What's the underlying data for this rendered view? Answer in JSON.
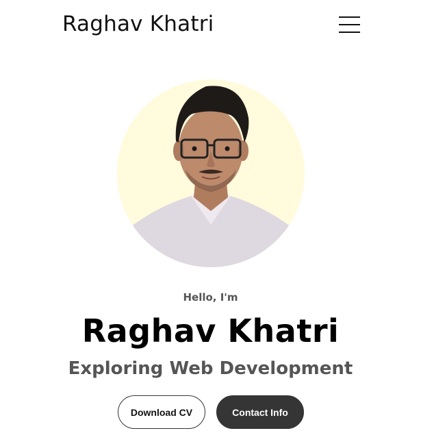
{
  "header": {
    "logo_text": "Raghav Khatri",
    "menu_icon": "hamburger-menu-icon"
  },
  "hero": {
    "profile_image_alt": "Profile photo of Raghav Khatri",
    "greeting": "Hello, I'm",
    "name": "Raghav Khatri",
    "tagline": "Exploring Web Development",
    "buttons": {
      "download_cv": "Download CV",
      "contact_info": "Contact Info"
    }
  },
  "colors": {
    "portrait_background": "#fffbdc",
    "button_dark": "#353535",
    "secondary_text": "#555555"
  }
}
